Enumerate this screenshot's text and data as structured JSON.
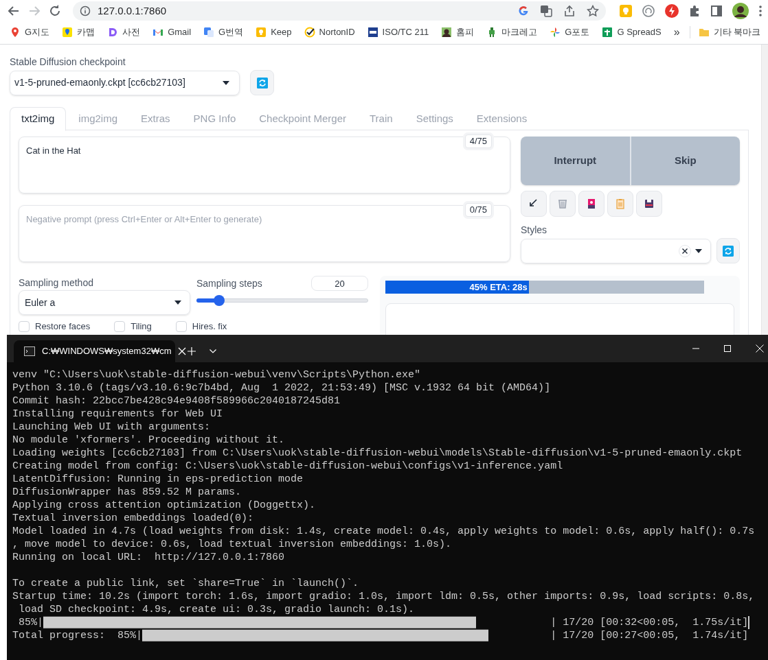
{
  "browser": {
    "url": "127.0.0.1:7860",
    "bookmarks": [
      {
        "label": "G지도"
      },
      {
        "label": "카맵"
      },
      {
        "label": "사전"
      },
      {
        "label": "Gmail"
      },
      {
        "label": "G번역"
      },
      {
        "label": "Keep"
      },
      {
        "label": "NortonID"
      },
      {
        "label": "ISO/TC 211"
      },
      {
        "label": "홈피"
      },
      {
        "label": "마크레고"
      },
      {
        "label": "G포토"
      },
      {
        "label": "G SpreadS"
      }
    ],
    "overflow": "»",
    "other_bookmarks": "기타 북마크"
  },
  "checkpoint": {
    "label": "Stable Diffusion checkpoint",
    "value": "v1-5-pruned-emaonly.ckpt [cc6cb27103]"
  },
  "tabs": [
    {
      "label": "txt2img",
      "selected": true
    },
    {
      "label": "img2img",
      "selected": false
    },
    {
      "label": "Extras",
      "selected": false
    },
    {
      "label": "PNG Info",
      "selected": false
    },
    {
      "label": "Checkpoint Merger",
      "selected": false
    },
    {
      "label": "Train",
      "selected": false
    },
    {
      "label": "Settings",
      "selected": false
    },
    {
      "label": "Extensions",
      "selected": false
    }
  ],
  "prompt": {
    "value": "Cat in the Hat",
    "token_count": "4/75"
  },
  "negative_prompt": {
    "placeholder": "Negative prompt (press Ctrl+Enter or Alt+Enter to generate)",
    "token_count": "0/75"
  },
  "buttons": [
    "Interrupt",
    "Skip"
  ],
  "styles": {
    "label": "Styles"
  },
  "sampling_method": {
    "label": "Sampling method",
    "value": "Euler a"
  },
  "sampling_steps": {
    "label": "Sampling steps",
    "value": "20",
    "level": 0.13
  },
  "checkboxes": [
    {
      "label": "Restore faces",
      "checked": false
    },
    {
      "label": "Tiling",
      "checked": false
    },
    {
      "label": "Hires. fix",
      "checked": false
    }
  ],
  "progress": {
    "text": "45% ETA: 28s",
    "level": 0.45
  },
  "terminal": {
    "tab_title": "C:₩WINDOWS₩system32₩cm",
    "lines": [
      {
        "kind": "text",
        "text": "venv \"C:\\Users\\uok\\stable-diffusion-webui\\venv\\Scripts\\Python.exe\""
      },
      {
        "kind": "text",
        "text": "Python 3.10.6 (tags/v3.10.6:9c7b4bd, Aug  1 2022, 21:53:49) [MSC v.1932 64 bit (AMD64)]"
      },
      {
        "kind": "text",
        "text": "Commit hash: 22bcc7be428c94e9408f589966c2040187245d81"
      },
      {
        "kind": "text",
        "text": "Installing requirements for Web UI"
      },
      {
        "kind": "text",
        "text": "Launching Web UI with arguments:"
      },
      {
        "kind": "text",
        "text": "No module 'xformers'. Proceeding without it."
      },
      {
        "kind": "text",
        "text": "Loading weights [cc6cb27103] from C:\\Users\\uok\\stable-diffusion-webui\\models\\Stable-diffusion\\v1-5-pruned-emaonly.ckpt"
      },
      {
        "kind": "text",
        "text": "Creating model from config: C:\\Users\\uok\\stable-diffusion-webui\\configs\\v1-inference.yaml"
      },
      {
        "kind": "text",
        "text": "LatentDiffusion: Running in eps-prediction mode"
      },
      {
        "kind": "text",
        "text": "DiffusionWrapper has 859.52 M params."
      },
      {
        "kind": "text",
        "text": "Applying cross attention optimization (Doggettx)."
      },
      {
        "kind": "text",
        "text": "Textual inversion embeddings loaded(0):"
      },
      {
        "kind": "text",
        "text": "Model loaded in 4.7s (load weights from disk: 1.4s, create model: 0.4s, apply weights to model: 0.6s, apply half(): 0.7s"
      },
      {
        "kind": "text",
        "text": ", move model to device: 0.6s, load textual inversion embeddings: 1.0s)."
      },
      {
        "kind": "text",
        "text": "Running on local URL:  http://127.0.0.1:7860"
      },
      {
        "kind": "blank"
      },
      {
        "kind": "text",
        "text": "To create a public link, set `share=True` in `launch()`."
      },
      {
        "kind": "text",
        "text": "Startup time: 10.2s (import torch: 1.6s, import gradio: 1.0s, import ldm: 0.5s, other imports: 0.9s, load scripts: 0.8s,"
      },
      {
        "kind": "text",
        "text": " load SD checkpoint: 4.9s, create ui: 0.3s, gradio launch: 0.1s)."
      },
      {
        "kind": "text",
        "text": " 85%|██████████████████████████████████████████████████████████████████████            | 17/20 [00:32<00:05,  1.75s/it]",
        "cursor": true
      },
      {
        "kind": "text",
        "text": "Total progress:  85%|████████████████████████████████████████████████████████          | 17/20 [00:27<00:05,  1.74s/it]"
      }
    ]
  }
}
